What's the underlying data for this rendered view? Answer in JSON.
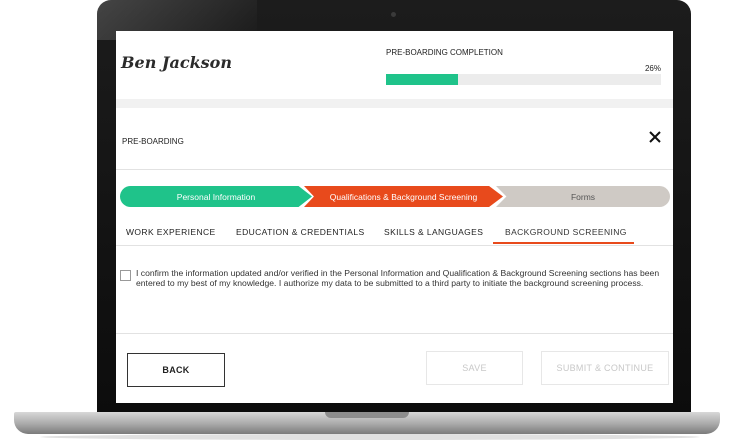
{
  "header": {
    "user_name": "Ben Jackson",
    "progress_title": "PRE-BOARDING COMPLETION",
    "progress_label": "26%",
    "progress_value": 0.26
  },
  "panel": {
    "title": "PRE-BOARDING",
    "close_icon": "close-icon"
  },
  "stepper": {
    "steps": [
      {
        "label": "Personal Information",
        "status": "complete",
        "color": "#1fc38a"
      },
      {
        "label": "Qualifications & Background Screening",
        "status": "active",
        "color": "#e84a1c"
      },
      {
        "label": "Forms",
        "status": "pending",
        "color": "#cfcac5"
      }
    ]
  },
  "tabs": [
    {
      "label": "WORK EXPERIENCE"
    },
    {
      "label": "EDUCATION & CREDENTIALS"
    },
    {
      "label": "SKILLS & LANGUAGES"
    },
    {
      "label": "BACKGROUND SCREENING",
      "active": true
    }
  ],
  "consent": {
    "checked": false,
    "text": "I confirm the information updated and/or verified in the Personal Information and Qualification & Background Screening sections has been  entered to my best of my knowledge. I authorize my data  to be submitted to a third party to initiate the background screening process."
  },
  "buttons": {
    "back": "BACK",
    "save": "SAVE",
    "submit": "SUBMIT & CONTINUE"
  },
  "colors": {
    "accent_green": "#1fc38a",
    "accent_orange": "#e84a1c"
  }
}
